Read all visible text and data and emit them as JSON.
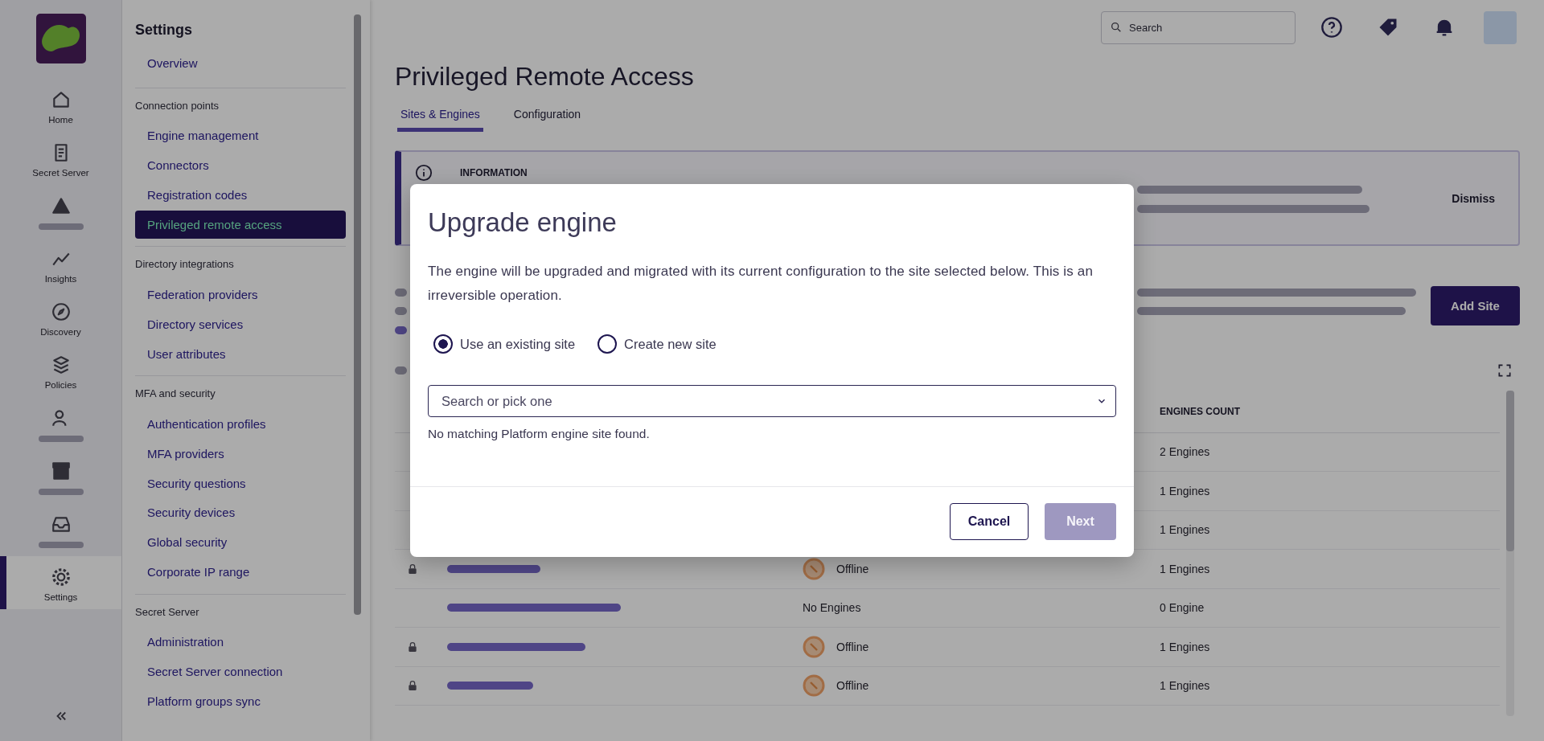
{
  "nav_rail": {
    "items": [
      {
        "label": "Home",
        "selected": false
      },
      {
        "label": "Secret Server",
        "selected": false
      },
      {
        "selected": false
      },
      {
        "label": "Insights",
        "selected": false
      },
      {
        "label": "Discovery",
        "selected": false
      },
      {
        "label": "Policies",
        "selected": false
      },
      {
        "selected": false
      },
      {
        "selected": false
      },
      {
        "selected": false
      },
      {
        "label": "Settings",
        "selected": true
      }
    ]
  },
  "settings_menu": {
    "title": "Settings",
    "sections": [
      {
        "items": [
          {
            "label": "Overview",
            "selected": false
          }
        ]
      },
      {
        "heading": "Connection points",
        "items": [
          {
            "label": "Engine management",
            "selected": false
          },
          {
            "label": "Connectors",
            "selected": false
          },
          {
            "label": "Registration codes",
            "selected": false
          },
          {
            "label": "Privileged remote access",
            "selected": true
          }
        ]
      },
      {
        "heading": "Directory integrations",
        "items": [
          {
            "label": "Federation providers",
            "selected": false
          },
          {
            "label": "Directory services",
            "selected": false
          },
          {
            "label": "User attributes",
            "selected": false
          }
        ]
      },
      {
        "heading": "MFA and security",
        "items": [
          {
            "label": "Authentication profiles",
            "selected": false
          },
          {
            "label": "MFA providers",
            "selected": false
          },
          {
            "label": "Security questions",
            "selected": false
          },
          {
            "label": "Security devices",
            "selected": false
          },
          {
            "label": "Global security",
            "selected": false
          },
          {
            "label": "Corporate IP range",
            "selected": false
          }
        ]
      },
      {
        "heading": "Secret Server",
        "items": [
          {
            "label": "Administration",
            "selected": false
          },
          {
            "label": "Secret Server connection",
            "selected": false
          },
          {
            "label": "Platform groups sync",
            "selected": false
          }
        ]
      }
    ]
  },
  "top_bar": {
    "search": {
      "placeholder": "Search"
    }
  },
  "page": {
    "title": "Privileged Remote Access",
    "tabs": [
      {
        "label": "Sites & Engines",
        "selected": true
      },
      {
        "label": "Configuration",
        "selected": false
      }
    ],
    "banner": {
      "heading": "INFORMATION",
      "action": "Dismiss"
    },
    "add_button": "Add Site",
    "table": {
      "count_header": "ENGINES COUNT",
      "rows": [
        {
          "count": "2 Engines"
        },
        {
          "count": "1 Engines"
        },
        {
          "count": "1 Engines"
        },
        {
          "lock": true,
          "status": {
            "kind": "offline",
            "text": "Offline"
          },
          "count": "1 Engines"
        },
        {
          "lock": false,
          "status": {
            "kind": "none",
            "text": "No Engines"
          },
          "count": "0 Engine"
        },
        {
          "lock": true,
          "status": {
            "kind": "offline",
            "text": "Offline"
          },
          "count": "1 Engines"
        },
        {
          "lock": true,
          "status": {
            "kind": "offline",
            "text": "Offline"
          },
          "count": "1 Engines"
        }
      ]
    }
  },
  "dialog": {
    "title": "Upgrade engine",
    "message": "The engine will be upgraded and migrated with its current configuration to the site selected below. This is an irreversible operation.",
    "options": [
      {
        "label": "Use an existing site",
        "selected": true
      },
      {
        "label": "Create new site",
        "selected": false
      }
    ],
    "site_select": {
      "placeholder": "Search or pick one"
    },
    "hint": "No matching Platform engine site found.",
    "buttons": [
      {
        "label": "Cancel",
        "kind": "secondary",
        "disabled": false
      },
      {
        "label": "Next",
        "kind": "primary",
        "disabled": true
      }
    ]
  }
}
